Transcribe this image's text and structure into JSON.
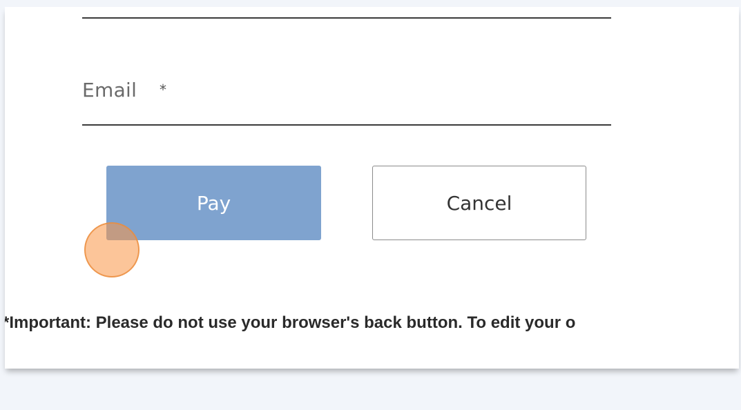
{
  "form": {
    "email_label": "Email",
    "required_marker": "*"
  },
  "buttons": {
    "pay_label": "Pay",
    "cancel_label": "Cancel"
  },
  "notice": {
    "text": "*Important: Please do not use your browser's back button. To edit your o"
  },
  "colors": {
    "pay_button_bg": "#7fa3cf",
    "click_indicator": "#fa9646"
  }
}
